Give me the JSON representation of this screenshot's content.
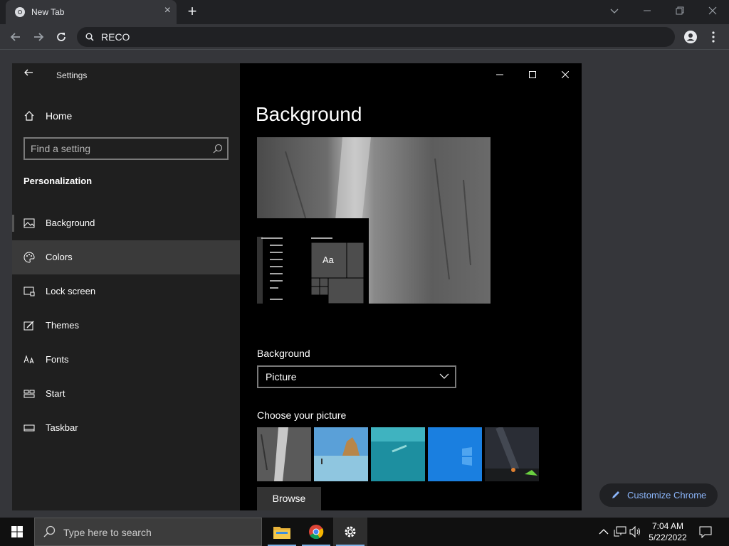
{
  "browser": {
    "tab_title": "New Tab",
    "tab_close": "×",
    "new_tab": "+",
    "omnibox_text": "RECO"
  },
  "settings": {
    "window_title": "Settings",
    "home_label": "Home",
    "search_placeholder": "Find a setting",
    "section_title": "Personalization",
    "nav_items": [
      {
        "label": "Background",
        "icon": "picture-icon"
      },
      {
        "label": "Colors",
        "icon": "palette-icon"
      },
      {
        "label": "Lock screen",
        "icon": "lock-screen-icon"
      },
      {
        "label": "Themes",
        "icon": "themes-icon"
      },
      {
        "label": "Fonts",
        "icon": "fonts-icon"
      },
      {
        "label": "Start",
        "icon": "start-icon"
      },
      {
        "label": "Taskbar",
        "icon": "taskbar-icon"
      }
    ],
    "page_title": "Background",
    "preview_sample": "Aa",
    "background_label": "Background",
    "background_value": "Picture",
    "choose_label": "Choose your picture",
    "browse_label": "Browse"
  },
  "customize_chrome": "Customize Chrome",
  "taskbar": {
    "search_text": "Type here to search",
    "time": "7:04 AM",
    "date": "5/22/2022"
  },
  "colors": {
    "accent_blue": "#8ab4f8",
    "taskbar_underline": "#7fb2e6"
  }
}
